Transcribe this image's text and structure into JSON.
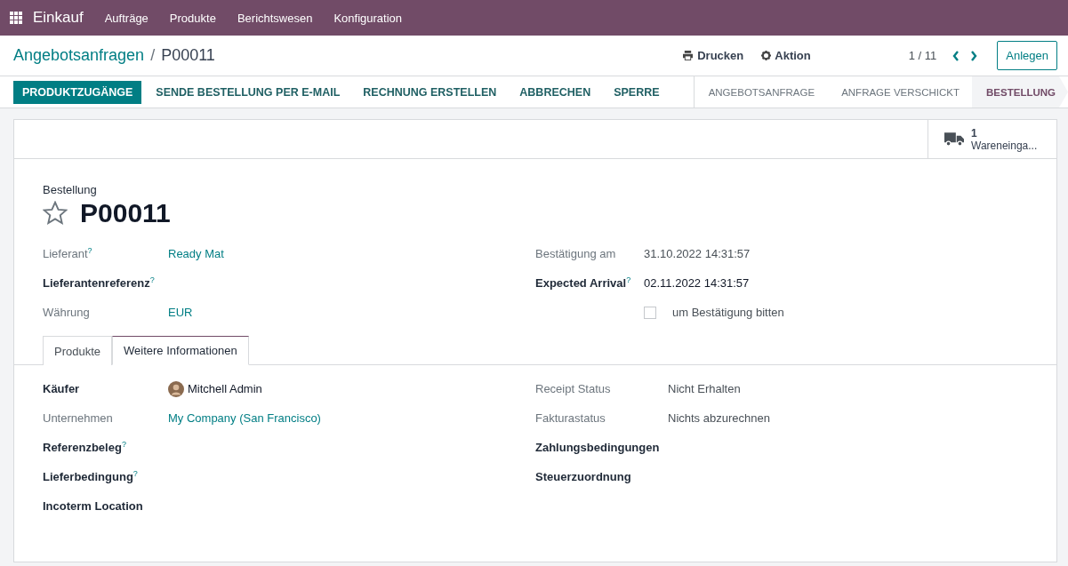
{
  "navbar": {
    "app": "Einkauf",
    "menu": [
      "Aufträge",
      "Produkte",
      "Berichtswesen",
      "Konfiguration"
    ]
  },
  "breadcrumb": {
    "parent": "Angebotsanfragen",
    "separator": "/",
    "current": "P00011"
  },
  "actions": {
    "print": "Drucken",
    "action": "Aktion",
    "pager": "1 / 11",
    "create": "Anlegen"
  },
  "buttons": [
    {
      "label": "PRODUKTZUGÄNGE",
      "primary": true
    },
    {
      "label": "SENDE BESTELLUNG PER E-MAIL",
      "primary": false
    },
    {
      "label": "RECHNUNG ERSTELLEN",
      "primary": false
    },
    {
      "label": "ABBRECHEN",
      "primary": false
    },
    {
      "label": "SPERRE",
      "primary": false
    }
  ],
  "stages": [
    {
      "label": "ANGEBOTSANFRAGE",
      "selected": false
    },
    {
      "label": "ANFRAGE VERSCHICKT",
      "selected": false
    },
    {
      "label": "BESTELLUNG",
      "selected": true
    }
  ],
  "smart_button": {
    "count": "1",
    "label": "Wareneinga..."
  },
  "record": {
    "type_label": "Bestellung",
    "name": "P00011",
    "starred": false
  },
  "header_left": [
    {
      "label": "Lieferant$^{?}$",
      "bold": false,
      "kind": "link",
      "value": "Ready Mat"
    },
    {
      "label": "Lieferantenreferenz$^{?}$",
      "bold": true,
      "kind": "empty"
    },
    {
      "label": "Währung",
      "bold": false,
      "kind": "link",
      "value": "EUR"
    }
  ],
  "header_right": [
    {
      "label": "Bestätigung am",
      "bold": false,
      "kind": "text",
      "value": "31.10.2022 14:31:57"
    },
    {
      "label": "Expected Arrival$^{?}$",
      "bold": true,
      "kind": "strong",
      "value": "02.11.2022 14:31:57"
    },
    {
      "kind": "checkbox",
      "value": "um Bestätigung bitten",
      "checked": false
    }
  ],
  "tabs": [
    {
      "label": "Produkte",
      "selected": false
    },
    {
      "label": "Weitere Informationen",
      "selected": true
    }
  ],
  "info_left": [
    {
      "label": "Käufer",
      "bold": true,
      "kind": "user",
      "value": "Mitchell Admin"
    },
    {
      "label": "Unternehmen",
      "bold": false,
      "kind": "link",
      "value": "My Company (San Francisco)"
    },
    {
      "label": "Referenzbeleg$^{?}$",
      "bold": true,
      "kind": "empty"
    },
    {
      "label": "Lieferbedingung$^{?}$",
      "bold": true,
      "kind": "empty"
    },
    {
      "label": "Incoterm Location",
      "bold": true,
      "kind": "empty"
    }
  ],
  "info_right": [
    {
      "label": "Receipt Status",
      "bold": false,
      "kind": "text",
      "value": "Nicht Erhalten"
    },
    {
      "label": "Fakturastatus",
      "bold": false,
      "kind": "text",
      "value": "Nichts abzurechnen"
    },
    {
      "label": "Zahlungsbedingungen",
      "bold": true,
      "kind": "empty"
    },
    {
      "label": "Steuerzuordnung",
      "bold": true,
      "kind": "empty"
    }
  ]
}
